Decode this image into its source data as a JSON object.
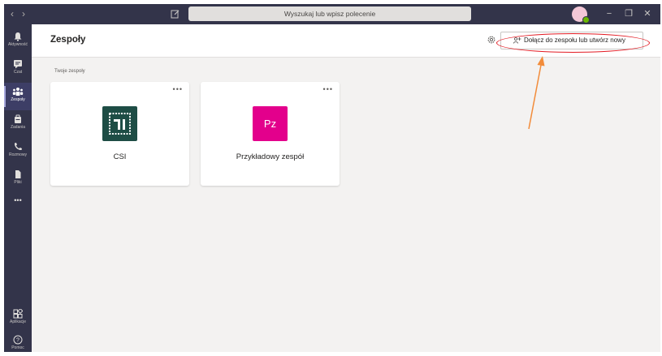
{
  "titlebar": {
    "search_placeholder": "Wyszukaj lub wpisz polecenie"
  },
  "window_controls": [
    "−",
    "❐",
    "✕"
  ],
  "rail": {
    "items": [
      {
        "label": "Aktywność",
        "icon": "bell-icon"
      },
      {
        "label": "Czat",
        "icon": "chat-icon"
      },
      {
        "label": "Zespoły",
        "icon": "teams-icon",
        "active": true
      },
      {
        "label": "Zadania",
        "icon": "tasks-icon"
      },
      {
        "label": "Rozmowy",
        "icon": "phone-icon"
      },
      {
        "label": "Pliki",
        "icon": "file-icon"
      }
    ],
    "more": "•••",
    "bottom": [
      {
        "label": "Aplikacje",
        "icon": "apps-icon"
      },
      {
        "label": "Pomoc",
        "icon": "help-icon"
      }
    ]
  },
  "header": {
    "title": "Zespoły",
    "join_button": "Dołącz do zespołu lub utwórz nowy"
  },
  "section_label": "Twoje zespoły",
  "teams": [
    {
      "name": "CSI",
      "more": "•••"
    },
    {
      "name": "Przykładowy zespół",
      "initials": "Pz",
      "more": "•••"
    }
  ],
  "colors": {
    "rail": "#33344a",
    "accent": "#6264a7",
    "annotation": "#e31b23",
    "arrow": "#f28c3a",
    "pz_logo": "#e3008c",
    "csi_logo": "#1e4d45"
  }
}
